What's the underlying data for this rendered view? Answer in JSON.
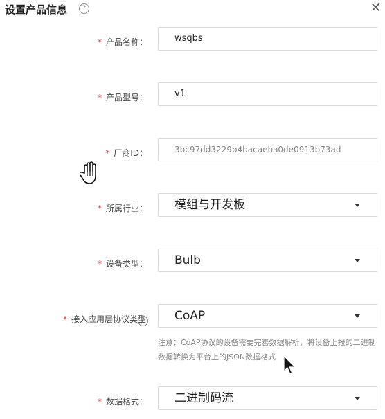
{
  "dialog": {
    "title": "设置产品信息",
    "help_glyph": "?",
    "close_glyph": "✕"
  },
  "fields": {
    "product_name": {
      "label": "产品名称：",
      "value": "wsqbs"
    },
    "product_model": {
      "label": "产品型号：",
      "value": "v1"
    },
    "vendor_id": {
      "label": "厂商ID：",
      "value": "3bc97dd3229b4bacaeba0de0913b73ad"
    },
    "industry": {
      "label": "所属行业：",
      "value": "模组与开发板"
    },
    "device_type": {
      "label": "设备类型：",
      "value": "Bulb"
    },
    "protocol": {
      "label": "接入应用层协议类型",
      "value": "CoAP",
      "note": "注意：CoAP协议的设备需要完善数据解析，将设备上报的二进制数据转换为平台上的JSON数据格式"
    },
    "data_format": {
      "label": "数据格式：",
      "value": "二进制码流"
    }
  },
  "required_mark": "*",
  "colors": {
    "required": "#e4393c",
    "border": "#d9d9d9"
  },
  "icons": [
    "help-icon",
    "close-icon",
    "chevron-down-icon",
    "hand-cursor-icon",
    "pointer-cursor-icon"
  ]
}
